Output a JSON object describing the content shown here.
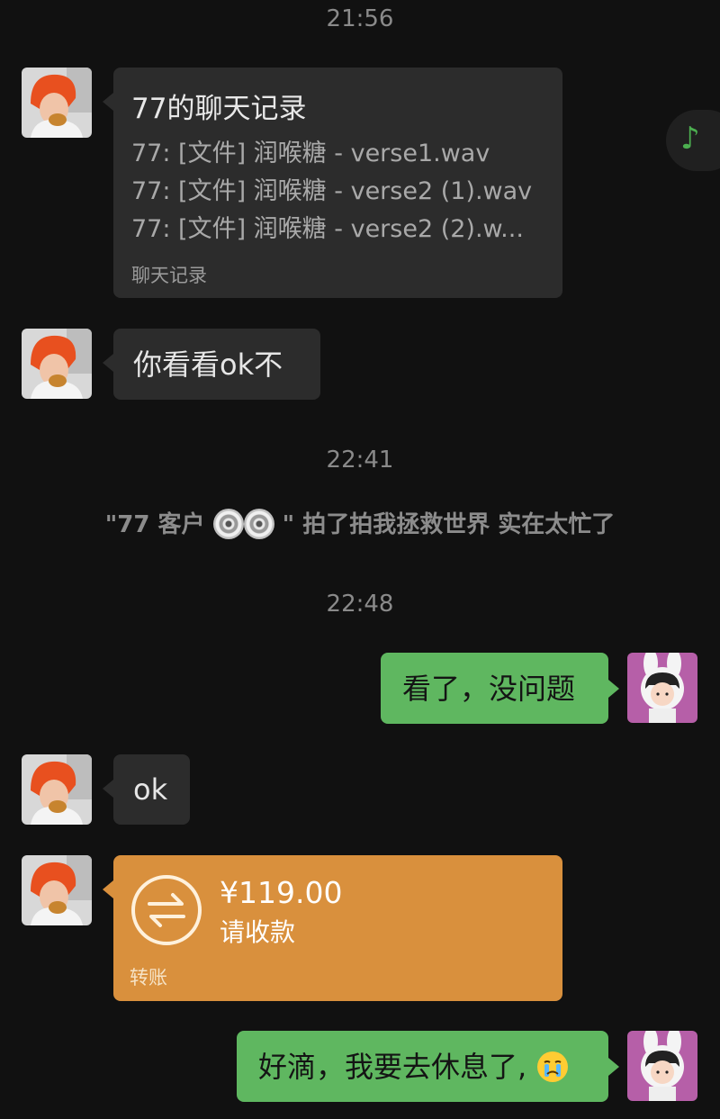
{
  "timestamps": {
    "t1": "21:56",
    "t2": "22:41",
    "t3": "22:48"
  },
  "chat_record": {
    "title": "77的聊天记录",
    "lines": [
      "77: [文件] 润喉糖 - verse1.wav",
      "77: [文件] 润喉糖 - verse2 (1).wav",
      "77: [文件] 润喉糖 - verse2 (2).w..."
    ],
    "footer": "聊天记录"
  },
  "messages": {
    "m1": "你看看ok不",
    "m2": "看了，没问题",
    "m3": "ok",
    "m5": "好滴，我要去休息了,"
  },
  "pat": {
    "prefix": "\"77 客户",
    "suffix": "\" 拍了拍我拯救世界 实在太忙了",
    "icons": [
      "cd-icon",
      "cd-icon"
    ]
  },
  "transfer": {
    "amount": "¥119.00",
    "status": "请收款",
    "footer": "转账"
  },
  "icons": {
    "floating": "music-note-icon",
    "emoji": "crying-face-icon",
    "transfer": "transfer-icon"
  },
  "colors": {
    "background": "#111111",
    "bubble_dark": "#2c2c2c",
    "bubble_green": "#5fb760",
    "bubble_orange": "#d9903d",
    "accent_green": "#4caf50"
  }
}
